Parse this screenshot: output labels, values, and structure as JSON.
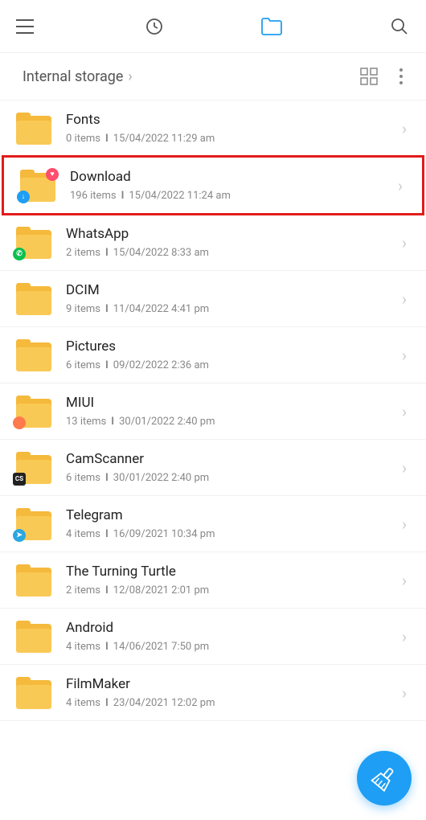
{
  "breadcrumb": {
    "title": "Internal storage"
  },
  "folders": [
    {
      "name": "Fonts",
      "items": "0 items",
      "date": "15/04/2022 11:29 am",
      "highlighted": false,
      "badge": null,
      "badgeTR": null
    },
    {
      "name": "Download",
      "items": "196 items",
      "date": "15/04/2022 11:24 am",
      "highlighted": true,
      "badge": {
        "bg": "#1e9ef4",
        "txt": "↓"
      },
      "badgeTR": {
        "bg": "#ff4d6d",
        "txt": "♥"
      }
    },
    {
      "name": "WhatsApp",
      "items": "2 items",
      "date": "15/04/2022 8:33 am",
      "highlighted": false,
      "badge": {
        "bg": "#0dbf4f",
        "txt": "✆"
      },
      "badgeTR": null
    },
    {
      "name": "DCIM",
      "items": "9 items",
      "date": "11/04/2022 4:41 pm",
      "highlighted": false,
      "badge": null,
      "badgeTR": null
    },
    {
      "name": "Pictures",
      "items": "6 items",
      "date": "09/02/2022 2:36 am",
      "highlighted": false,
      "badge": null,
      "badgeTR": null
    },
    {
      "name": "MIUI",
      "items": "13 items",
      "date": "30/01/2022 2:40 pm",
      "highlighted": false,
      "badge": {
        "bg": "#ff7a4d",
        "txt": ""
      },
      "badgeTR": null
    },
    {
      "name": "CamScanner",
      "items": "6 items",
      "date": "30/01/2022 2:40 pm",
      "highlighted": false,
      "badge": {
        "bg": "#222",
        "txt": "CS"
      },
      "badgeTR": null
    },
    {
      "name": "Telegram",
      "items": "4 items",
      "date": "16/09/2021 10:34 pm",
      "highlighted": false,
      "badge": {
        "bg": "#2aa7e0",
        "txt": "➤"
      },
      "badgeTR": null
    },
    {
      "name": "The Turning Turtle",
      "items": "2 items",
      "date": "12/08/2021 2:01 pm",
      "highlighted": false,
      "badge": null,
      "badgeTR": null
    },
    {
      "name": "Android",
      "items": "4 items",
      "date": "14/06/2021 7:50 pm",
      "highlighted": false,
      "badge": null,
      "badgeTR": null
    },
    {
      "name": "FilmMaker",
      "items": "4 items",
      "date": "23/04/2021 12:02 pm",
      "highlighted": false,
      "badge": null,
      "badgeTR": null
    }
  ]
}
